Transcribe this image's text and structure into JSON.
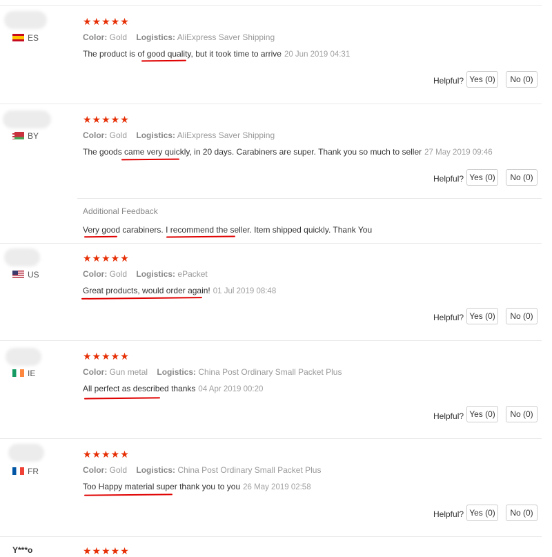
{
  "helpful_label": "Helpful?",
  "yes_label": "Yes (0)",
  "no_label": "No (0)",
  "color_key": "Color:",
  "logistics_key": "Logistics:",
  "stars_text": "★★★★★",
  "additional_feedback_label": "Additional Feedback",
  "colors": {
    "star": "#e62e04",
    "underline": "#e00000",
    "meta": "#999999"
  },
  "reviews": [
    {
      "country": "ES",
      "color": "Gold",
      "logistics": "AliExpress Saver Shipping",
      "text": "The product is of good quality, but it took time to arrive",
      "date": "20 Jun 2019 04:31"
    },
    {
      "country": "BY",
      "color": "Gold",
      "logistics": "AliExpress Saver Shipping",
      "text": "The goods came very quickly, in 20 days. Carabiners are super. Thank you so much to seller",
      "date": "27 May 2019 09:46",
      "additional": "Very good carabiners. I recommend the seller. Item shipped quickly. Thank You"
    },
    {
      "country": "US",
      "color": "Gold",
      "logistics": "ePacket",
      "text": "Great products, would order again!",
      "date": "01 Jul 2019 08:48"
    },
    {
      "country": "IE",
      "color": "Gun metal",
      "logistics": "China Post Ordinary Small Packet Plus",
      "text": "All perfect as described thanks",
      "date": "04 Apr 2019 00:20"
    },
    {
      "country": "FR",
      "color": "Gold",
      "logistics": "China Post Ordinary Small Packet Plus",
      "text": "Too Happy material super thank you to you",
      "date": "26 May 2019 02:58"
    }
  ],
  "next_reviewer": "Y***o"
}
